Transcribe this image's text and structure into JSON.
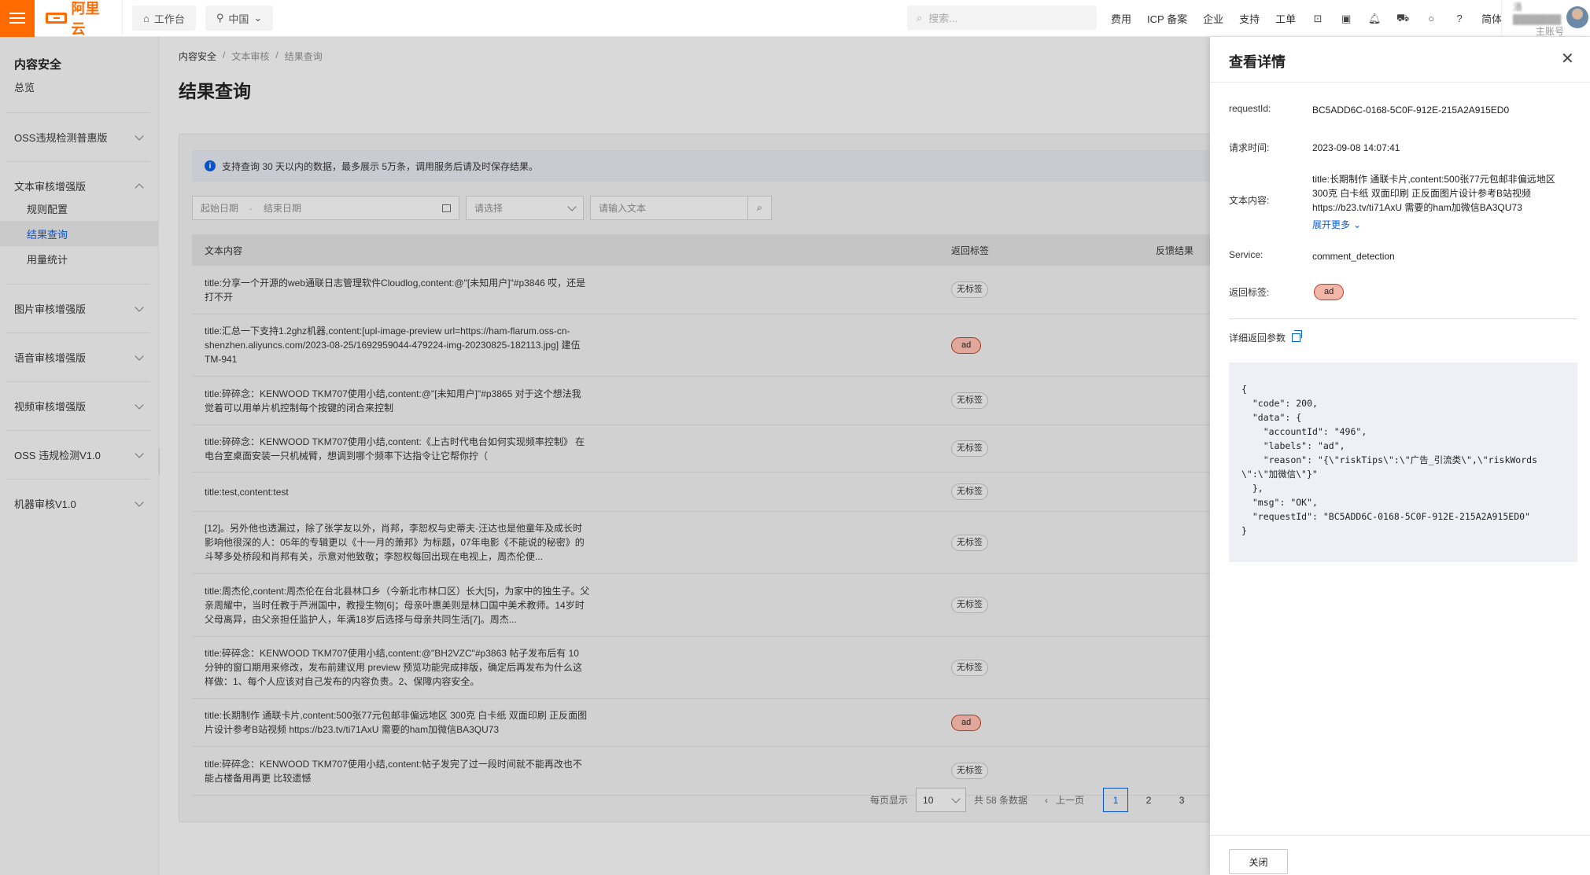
{
  "topbar": {
    "logo": "阿里云",
    "workbench": "工作台",
    "region": "中国",
    "search_placeholder": "搜索...",
    "links": [
      "费用",
      "ICP 备案",
      "企业",
      "支持",
      "工单"
    ],
    "language": "简体",
    "user_name": "潘▓▓▓▓▓▓▓",
    "user_role": "主账号"
  },
  "sidebar": {
    "title": "内容安全",
    "overview": "总览",
    "groups": [
      {
        "label": "OSS违规检测普惠版",
        "expanded": false
      },
      {
        "label": "文本审核增强版",
        "expanded": true,
        "items": [
          "规则配置",
          "结果查询",
          "用量统计"
        ],
        "active_index": 1
      },
      {
        "label": "图片审核增强版",
        "expanded": false
      },
      {
        "label": "语音审核增强版",
        "expanded": false
      },
      {
        "label": "视频审核增强版",
        "expanded": false
      },
      {
        "label": "OSS 违规检测V1.0",
        "expanded": false
      },
      {
        "label": "机器审核V1.0",
        "expanded": false
      }
    ]
  },
  "main": {
    "breadcrumb": [
      "内容安全",
      "文本审核",
      "结果查询"
    ],
    "title": "结果查询",
    "notice": "支持查询 30 天以内的数据，最多展示 5万条，调用服务后请及时保存结果。",
    "filters": {
      "start_date": "起始日期",
      "end_date": "结束日期",
      "select_placeholder": "请选择",
      "text_placeholder": "请输入文本"
    },
    "table": {
      "headers": [
        "文本内容",
        "返回标签",
        "反馈结果"
      ],
      "rows": [
        {
          "text": "title:分享一个开源的web通联日志管理软件Cloudlog,content:@\"[未知用户]\"#p3846 哎，还是打不开",
          "label": "无标签"
        },
        {
          "text": "title:汇总一下支持1.2ghz机器,content:[upl-image-preview url=https://ham-flarum.oss-cn-shenzhen.aliyuncs.com/2023-08-25/1692959044-479224-img-20230825-182113.jpg] 建伍TM-941",
          "label": "ad"
        },
        {
          "text": "title:碎碎念：KENWOOD TKM707使用小结,content:@\"[未知用户]\"#p3865 对于这个想法我觉着可以用单片机控制每个按键的闭合来控制",
          "label": "无标签"
        },
        {
          "text": "title:碎碎念：KENWOOD TKM707使用小结,content:《上古时代电台如何实现频率控制》 在电台室桌面安装一只机械臂，想调到哪个频率下达指令让它帮你拧（",
          "label": "无标签"
        },
        {
          "text": "title:test,content:test",
          "label": "无标签"
        },
        {
          "text": "[12]。另外他也透漏过，除了张学友以外，肖邦，李恕权与史蒂夫·汪达也是他童年及成长时影响他很深的人：05年的专辑更以《十一月的萧邦》为标题，07年电影《不能说的秘密》的斗琴多处桥段和肖邦有关，示意对他致敬；李恕权每回出现在电视上，周杰伦便...",
          "label": "无标签"
        },
        {
          "text": "title:周杰伦,content:周杰伦在台北县林口乡（今新北市林口区）长大[5]，为家中的独生子。父亲周耀中，当时任教于芦洲国中，教授生物[6]；母亲叶惠美则是林口国中美术教师。14岁时父母离异，由父亲担任监护人，年满18岁后选择与母亲共同生活[7]。周杰...",
          "label": "无标签"
        },
        {
          "text": "title:碎碎念：KENWOOD TKM707使用小结,content:@\"BH2VZC\"#p3863 帖子发布后有 10 分钟的窗口期用来修改，发布前建议用 preview 预览功能完成排版，确定后再发布为什么这样做：1、每个人应该对自己发布的内容负责。2、保障内容安全。",
          "label": "无标签"
        },
        {
          "text": "title:长期制作 通联卡片,content:500张77元包邮非偏远地区 300克 白卡纸 双面印刷 正反面图片设计参考B站视频 https://b23.tv/ti71AxU 需要的ham加微信BA3QU73",
          "label": "ad"
        },
        {
          "text": "title:碎碎念：KENWOOD TKM707使用小结,content:帖子发完了过一段时间就不能再改也不能占楼备用再更 比较遗憾",
          "label": "无标签"
        }
      ]
    },
    "pagination": {
      "per_page_label": "每页显示",
      "per_page": "10",
      "total": "共 58 条数据",
      "prev": "上一页",
      "pages": [
        "1",
        "2",
        "3"
      ],
      "current": "1"
    }
  },
  "drawer": {
    "title": "查看详情",
    "request_id_label": "requestId:",
    "request_id": "BC5ADD6C-0168-5C0F-912E-215A2A915ED0",
    "time_label": "请求时间:",
    "time": "2023-09-08 14:07:41",
    "content_label": "文本内容:",
    "content": "title:长期制作 通联卡片,content:500张77元包邮非偏远地区 300克 白卡纸 双面印刷 正反面图片设计参考B站视频 https://b23.tv/ti71AxU 需要的ham加微信BA3QU73",
    "expand_more": "展开更多",
    "service_label": "Service:",
    "service": "comment_detection",
    "label_label": "返回标签:",
    "label": "ad",
    "detail_label": "详细返回参数",
    "json": "{\n  \"code\": 200,\n  \"data\": {\n    \"accountId\": \"496\",\n    \"labels\": \"ad\",\n    \"reason\": \"{\\\"riskTips\\\":\\\"广告_引流类\\\",\\\"riskWords\\\":\\\"加微信\\\"}\"\n  },\n  \"msg\": \"OK\",\n  \"requestId\": \"BC5ADD6C-0168-5C0F-912E-215A2A915ED0\"\n}",
    "close_button": "关闭"
  },
  "colors": {
    "brand": "#ff6a00",
    "link": "#0b5bd3",
    "ad_tag_bg": "#f2b7a8",
    "ad_tag_border": "#c0392b"
  }
}
